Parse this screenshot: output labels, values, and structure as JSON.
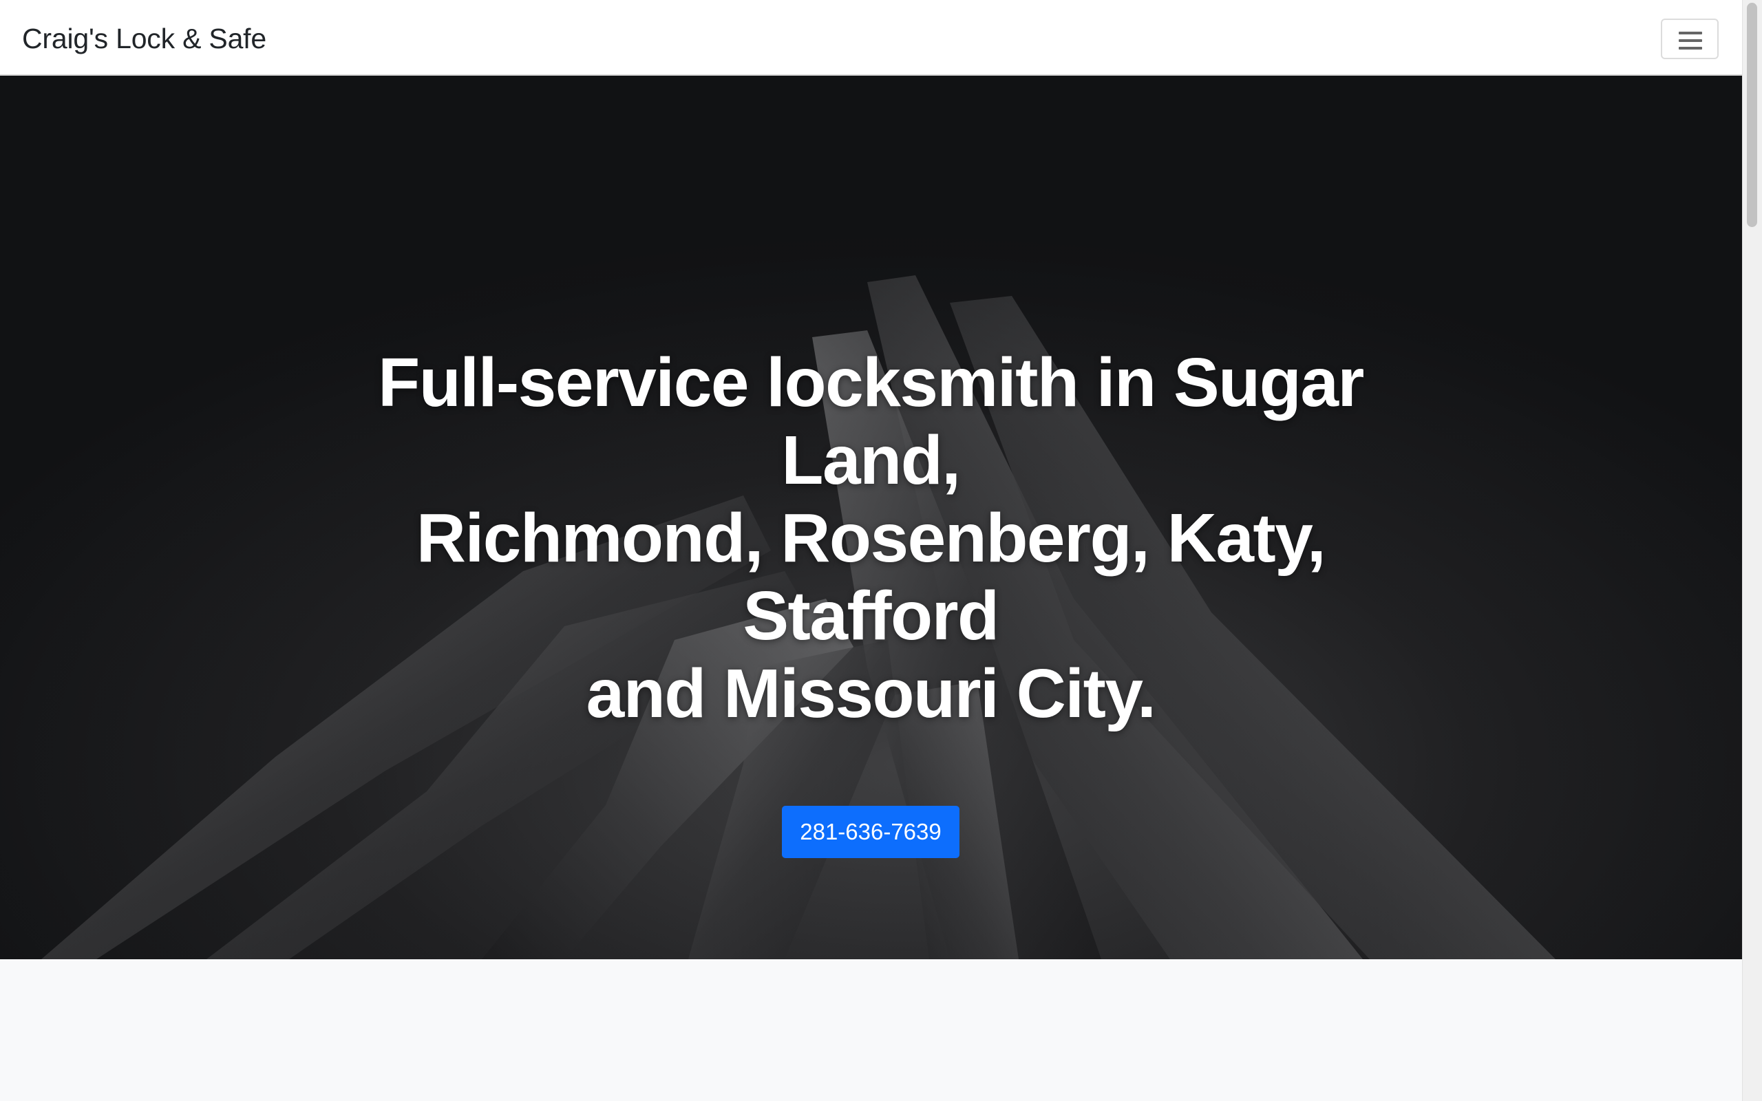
{
  "navbar": {
    "brand": "Craig's Lock & Safe",
    "toggler_icon": "hamburger-menu-icon"
  },
  "hero": {
    "headline_lines": [
      "Full-service locksmith in Sugar Land,",
      "Richmond, Rosenberg, Katy, Stafford",
      "and Missouri City."
    ],
    "cta_label": "281-636-7639",
    "background_image": "keys-photo",
    "colors": {
      "overlay": "#121315",
      "cta": "#0d6efd"
    }
  }
}
